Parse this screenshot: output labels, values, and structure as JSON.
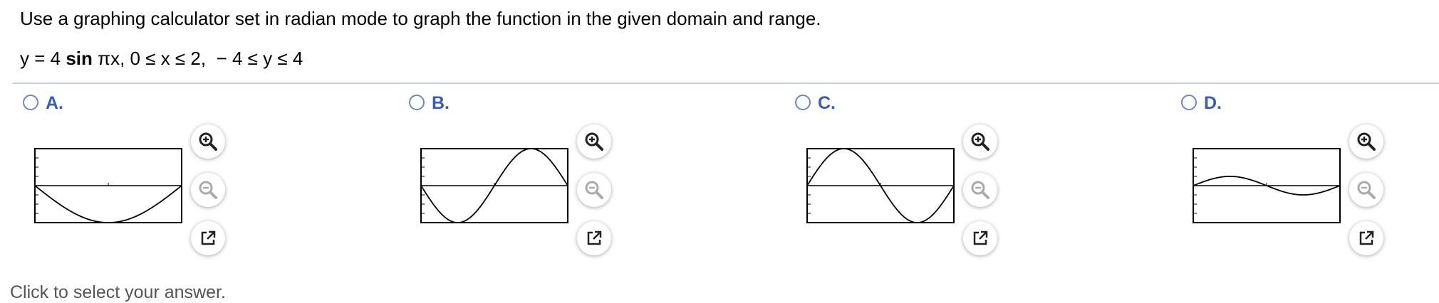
{
  "question": {
    "instruction": "Use a graphing calculator set in radian mode to graph the function in the given domain and range.",
    "equation": {
      "lhs": "y = 4 ",
      "func": "sin",
      "argument": " πx,",
      "domain": "0 ≤ x ≤ 2,",
      "range": "− 4 ≤ y ≤ 4"
    }
  },
  "options": [
    {
      "label": "A.",
      "selected": false,
      "graph": "y = -4 sin(πx/2)"
    },
    {
      "label": "B.",
      "selected": false,
      "graph": "y = -4 sin(πx)"
    },
    {
      "label": "C.",
      "selected": false,
      "graph": "y = 4 sin(πx)"
    },
    {
      "label": "D.",
      "selected": false,
      "graph": "y = sin(πx)"
    }
  ],
  "graph_window": {
    "x_range": [
      0,
      2
    ],
    "y_range": [
      -4,
      4
    ]
  },
  "tools": {
    "zoom_in_icon": "magnifier-plus-icon",
    "zoom_out_icon": "magnifier-minus-icon",
    "popout_icon": "external-link-icon"
  },
  "footer": {
    "text": "Click to select your answer."
  },
  "colors": {
    "option_label": "#3c5bb5",
    "radio_border": "#6f87c8",
    "divider": "#c7cfe6"
  }
}
